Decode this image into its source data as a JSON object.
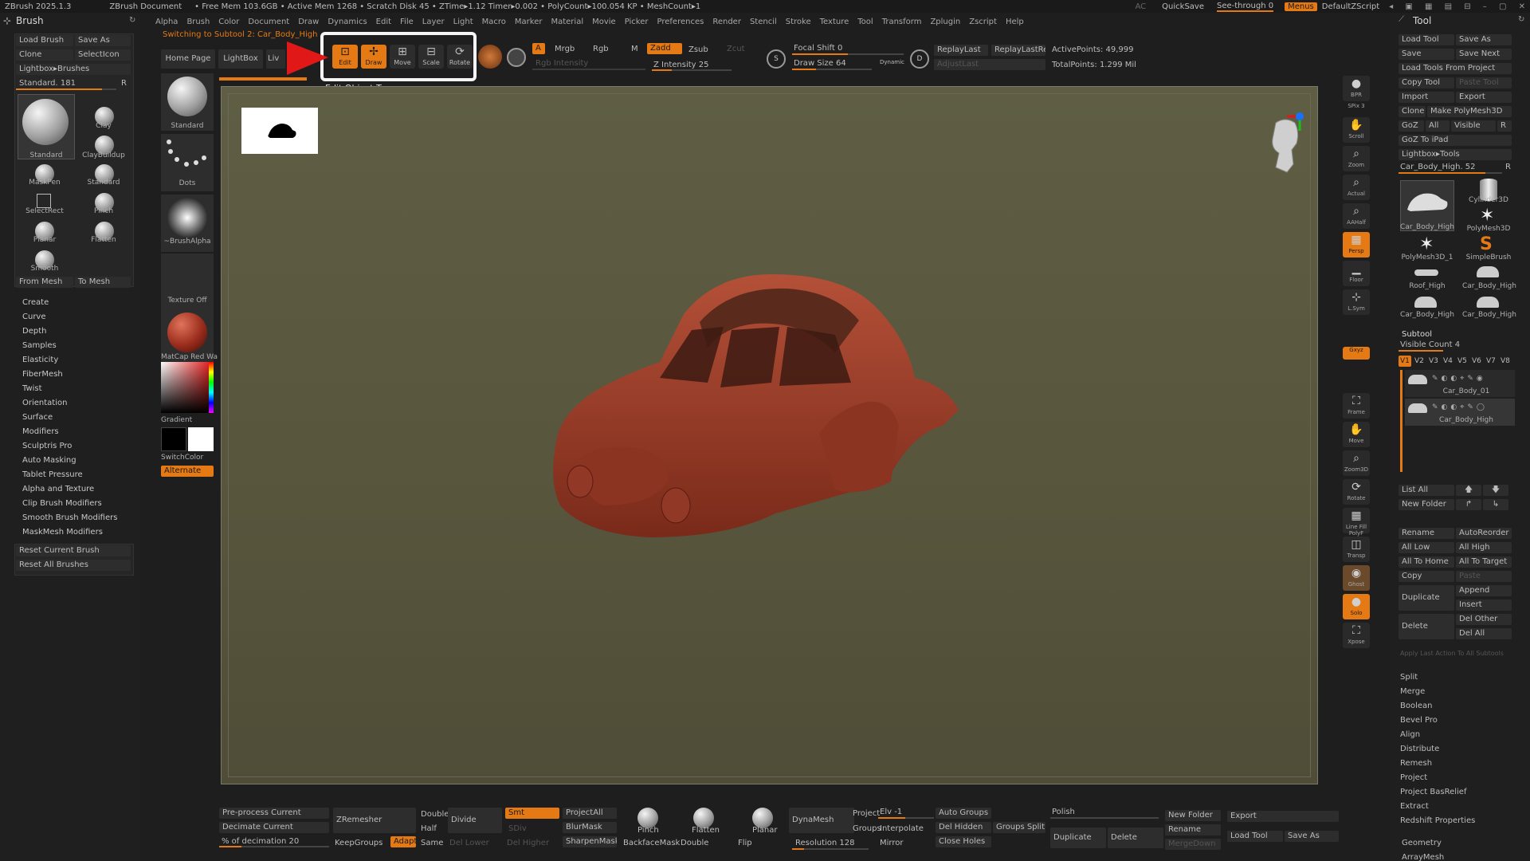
{
  "titlebar": {
    "app": "ZBrush 2025.1.3",
    "document": "ZBrush Document",
    "stats": "• Free Mem 103.6GB • Active Mem 1268 • Scratch Disk 45 • ZTime▸1.12 Timer▸0.002 • PolyCount▸100.054 KP • MeshCount▸1",
    "ac": "AC",
    "quicksave": "QuickSave",
    "see_through": "See-through  0",
    "menus": "Menus",
    "zscript": "DefaultZScript"
  },
  "menubar": [
    "Alpha",
    "Brush",
    "Color",
    "Document",
    "Draw",
    "Dynamics",
    "Edit",
    "File",
    "Layer",
    "Light",
    "Macro",
    "Marker",
    "Material",
    "Movie",
    "Picker",
    "Preferences",
    "Render",
    "Stencil",
    "Stroke",
    "Texture",
    "Tool",
    "Transform",
    "Zplugin",
    "Zscript",
    "Help"
  ],
  "status_line": "Switching to Subtool 2:  Car_Body_High",
  "tooltip": "Edit Object   T",
  "left_panel": {
    "title": "Brush",
    "load_brush": "Load Brush",
    "save_as": "Save As",
    "clone": "Clone",
    "select_icon": "SelectIcon",
    "lightbox_brushes": "Lightbox▸Brushes",
    "standard_size": "Standard. 181",
    "r": "R",
    "brushes": [
      "Standard",
      "Clay",
      "ClayBuildup",
      "MaskPen",
      "Standard",
      "SelectRect",
      "Pinch",
      "Planar",
      "Flatten",
      "Smooth"
    ],
    "from_mesh": "From Mesh",
    "to_mesh": "To Mesh",
    "menu": [
      "Create",
      "Curve",
      "Depth",
      "Samples",
      "Elasticity",
      "FiberMesh",
      "Twist",
      "Orientation",
      "Surface",
      "Modifiers",
      "Sculptris Pro",
      "Auto Masking",
      "Tablet Pressure",
      "Alpha and Texture",
      "Clip Brush Modifiers",
      "Smooth Brush Modifiers",
      "MaskMesh Modifiers"
    ],
    "reset_current": "Reset Current Brush",
    "reset_all": "Reset All Brushes"
  },
  "shelf": {
    "home_page": "Home Page",
    "lightbox": "LightBox",
    "live": "Liv",
    "standard": "Standard",
    "dots": "Dots",
    "brush_alpha": "~BrushAlpha",
    "texture_off": "Texture Off",
    "matcap": "MatCap Red Wa",
    "gradient": "Gradient",
    "switch_color": "SwitchColor",
    "alternate": "Alternate"
  },
  "top_toolbar": {
    "edit": "Edit",
    "draw": "Draw",
    "move": "Move",
    "scale": "Scale",
    "rotate": "Rotate",
    "a": "A",
    "mrgb": "Mrgb",
    "rgb": "Rgb",
    "m": "M",
    "zadd": "Zadd",
    "zsub": "Zsub",
    "zcut": "Zcut",
    "rgb_intensity": "Rgb Intensity",
    "z_intensity": "Z Intensity 25",
    "focal_shift": "Focal Shift 0",
    "draw_size": "Draw Size 64",
    "dynamic": "Dynamic",
    "replay_last": "ReplayLast",
    "replay_last_rel": "ReplayLastRel",
    "adjust_last": "AdjustLast",
    "active_points": "ActivePoints: 49,999",
    "total_points": "TotalPoints: 1.299 Mil"
  },
  "vtoolbar": [
    "BPR",
    "SPix 3",
    "Scroll",
    "Zoom",
    "Actual",
    "AAHalf",
    "Persp",
    "Floor",
    "L.Sym",
    "Gxyz",
    "Frame",
    "Move",
    "Zoom3D",
    "Rotate",
    "Line Fill PolyF",
    "Transp",
    "Ghost",
    "Solo",
    "Xpose"
  ],
  "right_panel": {
    "title": "Tool",
    "load_tool": "Load Tool",
    "save_as": "Save As",
    "save": "Save",
    "save_next": "Save Next",
    "load_from_project": "Load Tools From Project",
    "copy_tool": "Copy Tool",
    "paste_tool": "Paste Tool",
    "import": "Import",
    "export": "Export",
    "clone": "Clone",
    "make_polymesh": "Make PolyMesh3D",
    "goz": "GoZ",
    "all": "All",
    "visible": "Visible",
    "r": "R",
    "goz_ipad": "GoZ To iPad",
    "lightbox_tools": "Lightbox▸Tools",
    "current_tool": "Car_Body_High. 52",
    "tools": [
      "Car_Body_High",
      "Cylinder3D",
      "PolyMesh3D",
      "PolyMesh3D_1",
      "SimpleBrush",
      "Roof_High",
      "Car_Body_High",
      "Car_Body_High",
      "Car_Body_High"
    ],
    "subtool": "Subtool",
    "visible_count": "Visible Count 4",
    "versions": [
      "V1",
      "V2",
      "V3",
      "V4",
      "V5",
      "V6",
      "V7",
      "V8"
    ],
    "subtools": [
      "Car_Body_01",
      "Car_Body_High"
    ],
    "list_all": "List All",
    "new_folder": "New Folder",
    "rename": "Rename",
    "auto_reorder": "AutoReorder",
    "all_low": "All Low",
    "all_high": "All High",
    "all_to_home": "All To Home",
    "all_to_target": "All To Target",
    "copy": "Copy",
    "paste": "Paste",
    "duplicate": "Duplicate",
    "append": "Append",
    "insert": "Insert",
    "delete": "Delete",
    "del_other": "Del Other",
    "del_all": "Del All",
    "apply_last": "Apply Last Action To All Subtools",
    "menu": [
      "Split",
      "Merge",
      "Boolean",
      "Bevel Pro",
      "Align",
      "Distribute",
      "Remesh",
      "Project",
      "Project BasRelief",
      "Extract",
      "Redshift Properties"
    ],
    "geometry": "Geometry",
    "array_mesh": "ArrayMesh"
  },
  "bottom": {
    "preprocess": "Pre-process Current",
    "decimate": "Decimate Current",
    "pct_decimation": "% of decimation 20",
    "zremesher": "ZRemesher",
    "keep_groups": "KeepGroups",
    "adapt": "Adapt",
    "double": "Double",
    "half": "Half",
    "same": "Same",
    "divide": "Divide",
    "del_lower": "Del Lower",
    "smt": "Smt",
    "sdiv": "SDiv",
    "del_higher": "Del Higher",
    "project_all": "ProjectAll",
    "blur_mask": "BlurMask",
    "sharpen_mask": "SharpenMask",
    "pinch": "Pinch",
    "backface_mask": "BackfaceMask",
    "flatten": "Flatten",
    "double2": "Double",
    "planar": "Planar",
    "flip": "Flip",
    "dynamesh": "DynaMesh",
    "resolution": "Resolution 128",
    "project": "Project",
    "elv": "Elv -1",
    "groups": "Groups",
    "interpolate": "Interpolate",
    "mirror": "Mirror",
    "auto_groups": "Auto Groups",
    "del_hidden": "Del Hidden",
    "close_holes": "Close Holes",
    "groups_split": "Groups Split",
    "polish": "Polish",
    "duplicate": "Duplicate",
    "delete": "Delete",
    "new_folder": "New Folder",
    "rename": "Rename",
    "merge_down": "MergeDown",
    "export": "Export",
    "load_tool": "Load Tool",
    "save_as": "Save As"
  },
  "colors": {
    "accent": "#e57a14",
    "car": "#a3452f",
    "canvas": "#5a5840",
    "callout": "#e01818"
  }
}
